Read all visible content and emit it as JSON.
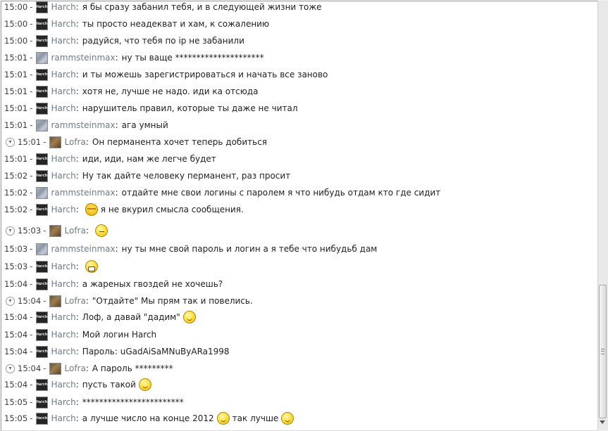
{
  "messages": [
    {
      "time": "15:00",
      "user": "Harch",
      "avatar": "harch",
      "parts": [
        {
          "t": "я бы сразу забанил тебя, и в следующей жизни тоже"
        }
      ]
    },
    {
      "time": "15:00",
      "user": "Harch",
      "avatar": "harch",
      "parts": [
        {
          "t": "ты просто неадекват и хам, к сожалению"
        }
      ]
    },
    {
      "time": "15:00",
      "user": "Harch",
      "avatar": "harch",
      "parts": [
        {
          "t": "радуйся, что тебя по ip не забанили"
        }
      ]
    },
    {
      "time": "15:01",
      "user": "rammsteinmax",
      "avatar": "ramm",
      "parts": [
        {
          "t": "ну ты ваще *********************"
        }
      ]
    },
    {
      "time": "15:01",
      "user": "Harch",
      "avatar": "harch",
      "parts": [
        {
          "t": "и ты можешь зарегистрироваться и начать все заново"
        }
      ]
    },
    {
      "time": "15:01",
      "user": "Harch",
      "avatar": "harch",
      "parts": [
        {
          "t": "хотя не, лучше не надо. иди ка отсюда"
        }
      ]
    },
    {
      "time": "15:01",
      "user": "Harch",
      "avatar": "harch",
      "parts": [
        {
          "t": "нарушитель правил, которые ты даже не читал"
        }
      ]
    },
    {
      "time": "15:01",
      "user": "rammsteinmax",
      "avatar": "ramm",
      "parts": [
        {
          "t": "ага умный"
        }
      ]
    },
    {
      "time": "15:01",
      "user": "Lofra",
      "avatar": "lofra",
      "toggle": true,
      "parts": [
        {
          "t": "Он перманента хочет теперь добиться"
        }
      ]
    },
    {
      "time": "15:01",
      "user": "Harch",
      "avatar": "harch",
      "parts": [
        {
          "t": "иди, иди, нам же легче будет"
        }
      ]
    },
    {
      "time": "15:02",
      "user": "Harch",
      "avatar": "harch",
      "parts": [
        {
          "t": "Ну так дайте человеку перманент, раз просит"
        }
      ]
    },
    {
      "time": "15:02",
      "user": "rammsteinmax",
      "avatar": "ramm",
      "parts": [
        {
          "t": "отдайте мне свои логины с паролем я что нибудь отдам кто где сидит"
        }
      ]
    },
    {
      "time": "15:02",
      "user": "Harch",
      "avatar": "harch",
      "parts": [
        {
          "e": "facepalm"
        },
        {
          "t": "я не вкурил смысла сообщения."
        }
      ]
    },
    {
      "time": "15:03",
      "user": "Lofra",
      "avatar": "lofra",
      "toggle": true,
      "parts": [
        {
          "e": "smug"
        }
      ]
    },
    {
      "time": "15:03",
      "user": "rammsteinmax",
      "avatar": "ramm",
      "parts": [
        {
          "t": "ну ты мне свой пароль и логин а я тебе что нибудьб дам"
        }
      ]
    },
    {
      "time": "15:03",
      "user": "Harch",
      "avatar": "harch",
      "parts": [
        {
          "e": "grin"
        }
      ]
    },
    {
      "time": "15:04",
      "user": "Harch",
      "avatar": "harch",
      "parts": [
        {
          "t": "а жареных гвоздей не хочешь?"
        }
      ]
    },
    {
      "time": "15:04",
      "user": "Lofra",
      "avatar": "lofra",
      "toggle": true,
      "parts": [
        {
          "t": "\"Отдайте\" Мы прям так и повелись."
        }
      ]
    },
    {
      "time": "15:04",
      "user": "Harch",
      "avatar": "harch",
      "parts": [
        {
          "t": "Лоф, а давай \"дадим\""
        },
        {
          "e": "smile"
        }
      ]
    },
    {
      "time": "15:04",
      "user": "Harch",
      "avatar": "harch",
      "parts": [
        {
          "t": "Мой логин Harch"
        }
      ]
    },
    {
      "time": "15:04",
      "user": "Harch",
      "avatar": "harch",
      "parts": [
        {
          "t": "Пароль: uGadAiSaMNuByARa1998"
        }
      ]
    },
    {
      "time": "15:04",
      "user": "Lofra",
      "avatar": "lofra",
      "toggle": true,
      "parts": [
        {
          "t": "А пароль *********"
        }
      ]
    },
    {
      "time": "15:04",
      "user": "Harch",
      "avatar": "harch",
      "parts": [
        {
          "t": "пусть такой"
        },
        {
          "e": "smile"
        }
      ]
    },
    {
      "time": "15:05",
      "user": "Harch",
      "avatar": "harch",
      "parts": [
        {
          "t": "************************"
        }
      ]
    },
    {
      "time": "15:05",
      "user": "Harch",
      "avatar": "harch",
      "parts": [
        {
          "t": "а лучше число на конце 2012"
        },
        {
          "e": "smile"
        },
        {
          "t": "так лучше"
        },
        {
          "e": "smile"
        }
      ]
    }
  ],
  "avatar_label": "Harch",
  "icons": {
    "toggle": "collapse-toggle-icon",
    "scroll": "scrollbar-grip-icon"
  },
  "colors": {
    "nick": "#6c7c88",
    "text": "#1e1e1e",
    "background": "#ffffff"
  }
}
